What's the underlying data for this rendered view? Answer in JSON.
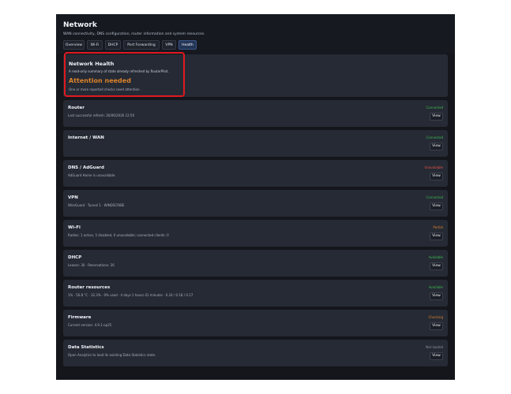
{
  "header": {
    "title": "Network",
    "subtitle": "WAN connectivity, DNS configuration, router information and system resources."
  },
  "tabs": [
    {
      "label": "Overview",
      "active": false
    },
    {
      "label": "Wi-Fi",
      "active": false
    },
    {
      "label": "DHCP",
      "active": false
    },
    {
      "label": "Port Forwarding",
      "active": false
    },
    {
      "label": "VPN",
      "active": false
    },
    {
      "label": "Health",
      "active": true
    }
  ],
  "health": {
    "title": "Network Health",
    "description": "A read-only summary of state already refreshed by RouterPilot.",
    "state": "Attention needed",
    "note": "One or more reported checks need attention."
  },
  "view_label": "View",
  "status_colors": {
    "ok": "#3fb950",
    "error": "#e5534b",
    "warn": "#d9822b",
    "muted": "#8b929e"
  },
  "cards": [
    {
      "title": "Router",
      "desc": "Last successful refresh: 26/06/2026 12:50",
      "status": "Connected",
      "level": "ok"
    },
    {
      "title": "Internet / WAN",
      "desc": "",
      "status": "Connected",
      "level": "ok"
    },
    {
      "title": "DNS / AdGuard",
      "desc": "AdGuard Home is unavailable.",
      "status": "Unavailable",
      "level": "error"
    },
    {
      "title": "VPN",
      "desc": "WireGuard · Tunnel 1 · WINDSCRIBE",
      "status": "Connected",
      "level": "ok"
    },
    {
      "title": "Wi-Fi",
      "desc": "Radios: 1 active, 5 disabled, 0 unavailable; connected clients: 0",
      "status": "Partial",
      "level": "warn"
    },
    {
      "title": "DHCP",
      "desc": "Leases: 30 · Reservations: 26",
      "status": "Available",
      "level": "ok"
    },
    {
      "title": "Router resources",
      "desc": "1% · 56.8 °C · 32.3% · 0% used · 4 days 1 hours 41 minutes · 0.24 / 0.18 / 0.17",
      "status": "Available",
      "level": "ok"
    },
    {
      "title": "Firmware",
      "desc": "Current version: 4.9.1-op25",
      "status": "Checking",
      "level": "warn"
    },
    {
      "title": "Data Statistics",
      "desc": "Open Analytics to load its existing Data Statistics state.",
      "status": "Not loaded",
      "level": "muted"
    }
  ]
}
